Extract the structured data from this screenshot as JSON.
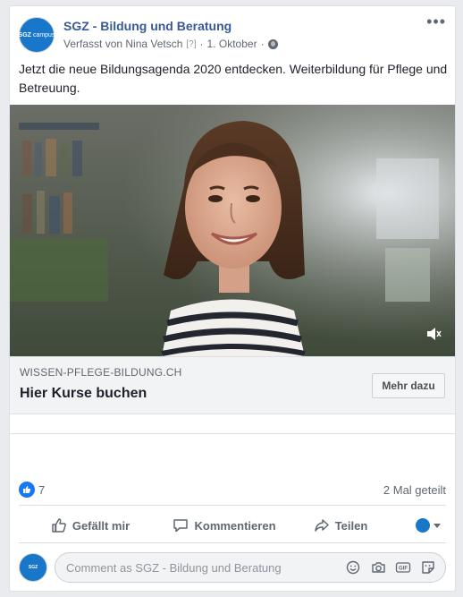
{
  "post": {
    "page_name": "SGZ - Bildung und Beratung",
    "avatar_text": "SGZ",
    "avatar_sub": "campus",
    "author_line": "Verfasst von Nina Vetsch",
    "author_badge": "[?]",
    "date": "1. Oktober",
    "separator": "·",
    "more_label": "•••",
    "text": "Jetzt die neue Bildungsagenda 2020 entdecken. Weiterbildung für Pflege und Betreuung."
  },
  "link_preview": {
    "domain": "WISSEN-PFLEGE-BILDUNG.CH",
    "headline": "Hier Kurse buchen",
    "cta_label": "Mehr dazu"
  },
  "stats": {
    "likes": "7",
    "shares": "2 Mal geteilt"
  },
  "actions": {
    "like": "Gefällt mir",
    "comment": "Kommentieren",
    "share": "Teilen"
  },
  "comment_box": {
    "placeholder": "Comment as SGZ - Bildung und Beratung",
    "icons": [
      "emoji-icon",
      "camera-icon",
      "gif-icon",
      "sticker-icon"
    ]
  },
  "colors": {
    "brand_blue": "#1877c9",
    "link_blue": "#385898",
    "like_blue": "#1877f2"
  }
}
